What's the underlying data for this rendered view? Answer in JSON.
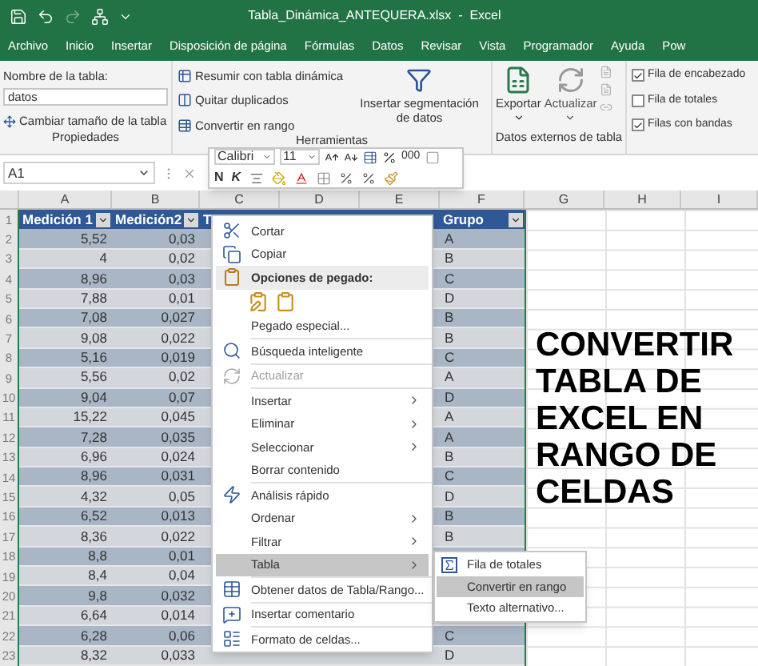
{
  "window": {
    "title": "Tabla_Dinámica_ANTEQUERA.xlsx  -  Excel"
  },
  "menu_tabs": [
    "Archivo",
    "Inicio",
    "Insertar",
    "Disposición de página",
    "Fórmulas",
    "Datos",
    "Revisar",
    "Vista",
    "Programador",
    "Ayuda",
    "Pow"
  ],
  "ribbon": {
    "properties": {
      "name_label": "Nombre de la tabla:",
      "name_value": "datos",
      "resize": "Cambiar tamaño de la tabla",
      "group": "Propiedades"
    },
    "tools": {
      "buttons": [
        "Resumir con tabla dinámica",
        "Quitar duplicados",
        "Convertir en rango"
      ],
      "slicer": "Insertar segmentación de datos",
      "group": "Herramientas"
    },
    "external": {
      "export": "Exportar",
      "refresh": "Actualizar",
      "group": "Datos externos de tabla"
    },
    "options": [
      {
        "label": "Fila de encabezado",
        "checked": true
      },
      {
        "label": "Fila de totales",
        "checked": false
      },
      {
        "label": "Filas con bandas",
        "checked": true
      }
    ]
  },
  "name_box": "A1",
  "mini_toolbar": {
    "font": "Calibri",
    "size": "11",
    "bold": "N",
    "italic": "K",
    "thousands": "000"
  },
  "columns": [
    "A",
    "B",
    "C",
    "D",
    "E",
    "F",
    "G",
    "H",
    "I"
  ],
  "table": {
    "header_row": "1",
    "headers": [
      "Medición 1",
      "Medición2",
      "T",
      "Grupo"
    ],
    "rows": [
      {
        "n": "2",
        "m1": "5,52",
        "m2": "0,03",
        "grupo": "A"
      },
      {
        "n": "3",
        "m1": "4",
        "m2": "0,02",
        "grupo": "B"
      },
      {
        "n": "4",
        "m1": "8,96",
        "m2": "0,03",
        "grupo": "C"
      },
      {
        "n": "5",
        "m1": "7,88",
        "m2": "0,01",
        "grupo": "D"
      },
      {
        "n": "6",
        "m1": "7,08",
        "m2": "0,027",
        "grupo": "B"
      },
      {
        "n": "7",
        "m1": "9,08",
        "m2": "0,022",
        "grupo": "B"
      },
      {
        "n": "8",
        "m1": "5,16",
        "m2": "0,019",
        "grupo": "C"
      },
      {
        "n": "9",
        "m1": "5,56",
        "m2": "0,02",
        "grupo": "A"
      },
      {
        "n": "10",
        "m1": "9,04",
        "m2": "0,07",
        "grupo": "D"
      },
      {
        "n": "11",
        "m1": "15,22",
        "m2": "0,045",
        "grupo": "A"
      },
      {
        "n": "12",
        "m1": "7,28",
        "m2": "0,035",
        "grupo": "A"
      },
      {
        "n": "13",
        "m1": "6,96",
        "m2": "0,024",
        "grupo": "B"
      },
      {
        "n": "14",
        "m1": "8,96",
        "m2": "0,031",
        "grupo": "C"
      },
      {
        "n": "15",
        "m1": "4,32",
        "m2": "0,05",
        "grupo": "D"
      },
      {
        "n": "16",
        "m1": "6,52",
        "m2": "0,013",
        "grupo": "B"
      },
      {
        "n": "17",
        "m1": "8,36",
        "m2": "0,022",
        "grupo": "B"
      },
      {
        "n": "18",
        "m1": "8,8",
        "m2": "0,01"
      },
      {
        "n": "19",
        "m1": "8,4",
        "m2": "0,04"
      },
      {
        "n": "20",
        "m1": "9,8",
        "m2": "0,032"
      },
      {
        "n": "21",
        "m1": "6,64",
        "m2": "0,014"
      },
      {
        "n": "22",
        "m1": "6,28",
        "m2": "0,06",
        "grupo": "C"
      },
      {
        "n": "23",
        "m1": "8,32",
        "m2": "0,033",
        "grupo": "D"
      }
    ]
  },
  "context_menu": {
    "items": [
      {
        "kind": "item",
        "label": "Cortar",
        "submenu": false,
        "disabled": false,
        "selected": false
      },
      {
        "kind": "item",
        "label": "Copiar",
        "submenu": false,
        "disabled": false,
        "selected": false
      },
      {
        "kind": "header",
        "label": "Opciones de pegado:"
      },
      {
        "kind": "paste_icons"
      },
      {
        "kind": "item",
        "label": "Pegado especial...",
        "submenu": false,
        "disabled": false,
        "selected": false
      },
      {
        "kind": "separator"
      },
      {
        "kind": "item",
        "label": "Búsqueda inteligente",
        "submenu": false,
        "disabled": false,
        "selected": false
      },
      {
        "kind": "separator"
      },
      {
        "kind": "item",
        "label": "Actualizar",
        "submenu": false,
        "disabled": true,
        "selected": false
      },
      {
        "kind": "separator"
      },
      {
        "kind": "item",
        "label": "Insertar",
        "submenu": true,
        "disabled": false,
        "selected": false
      },
      {
        "kind": "item",
        "label": "Eliminar",
        "submenu": true,
        "disabled": false,
        "selected": false
      },
      {
        "kind": "item",
        "label": "Seleccionar",
        "submenu": true,
        "disabled": false,
        "selected": false
      },
      {
        "kind": "item",
        "label": "Borrar contenido",
        "submenu": false,
        "disabled": false,
        "selected": false
      },
      {
        "kind": "separator"
      },
      {
        "kind": "item",
        "label": "Análisis rápido",
        "submenu": false,
        "disabled": false,
        "selected": false
      },
      {
        "kind": "item",
        "label": "Ordenar",
        "submenu": true,
        "disabled": false,
        "selected": false
      },
      {
        "kind": "item",
        "label": "Filtrar",
        "submenu": true,
        "disabled": false,
        "selected": false
      },
      {
        "kind": "item",
        "label": "Tabla",
        "submenu": true,
        "disabled": false,
        "selected": true
      },
      {
        "kind": "separator"
      },
      {
        "kind": "item",
        "label": "Obtener datos de Tabla/Rango...",
        "submenu": false,
        "disabled": false,
        "selected": false
      },
      {
        "kind": "separator"
      },
      {
        "kind": "item",
        "label": "Insertar comentario",
        "submenu": false,
        "disabled": false,
        "selected": false
      },
      {
        "kind": "separator"
      },
      {
        "kind": "item",
        "label": "Formato de celdas...",
        "submenu": false,
        "disabled": false,
        "selected": false
      }
    ]
  },
  "submenu": {
    "items": [
      {
        "label": "Fila de totales",
        "selected": false
      },
      {
        "label": "Convertir en rango",
        "selected": true
      },
      {
        "label": "Texto alternativo...",
        "selected": false
      }
    ]
  },
  "caption": [
    "CONVERTIR",
    "TABLA DE",
    "EXCEL EN",
    "RANGO DE",
    "CELDAS"
  ]
}
